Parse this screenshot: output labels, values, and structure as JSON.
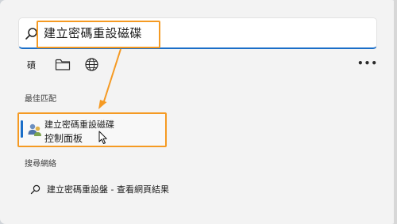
{
  "search": {
    "query": "建立密碼重設磁碟",
    "icon": "search-icon"
  },
  "filters": {
    "first_label": "磧",
    "folder_icon": "folder-icon",
    "globe_icon": "globe-icon",
    "more_icon": "more-icon"
  },
  "best_match": {
    "heading": "最佳匹配",
    "title": "建立密碼重設磁碟",
    "subtitle": "控制面板",
    "icon": "users-control-panel-icon"
  },
  "web": {
    "heading": "搜尋網絡",
    "suggestion": "建立密碼重設盤 - 查看網頁結果"
  },
  "colors": {
    "accent": "#1a6ec8",
    "highlight": "#f59a23"
  }
}
